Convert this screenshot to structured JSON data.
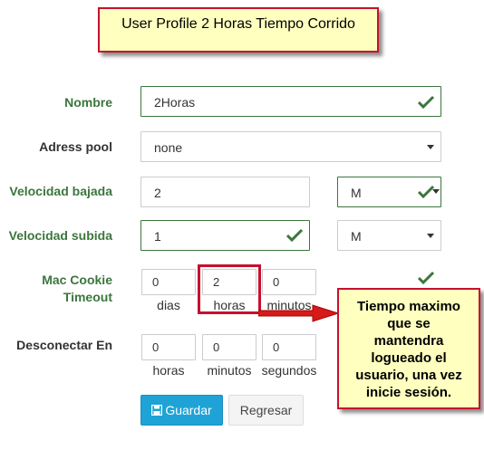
{
  "title": "User Profile 2 Horas Tiempo Corrido",
  "form": {
    "nombre": {
      "label": "Nombre",
      "value": "2Horas"
    },
    "adress_pool": {
      "label": "Adress pool",
      "value": "none"
    },
    "velocidad_bajada": {
      "label": "Velocidad bajada",
      "value": "2",
      "unit": "M"
    },
    "velocidad_subida": {
      "label": "Velocidad subida",
      "value": "1",
      "unit": "M"
    },
    "mac_cookie_timeout": {
      "label_line1": "Mac Cookie",
      "label_line2": "Timeout",
      "dias": "0",
      "horas": "2",
      "minutos": "0",
      "dias_label": "dias",
      "horas_label": "horas",
      "minutos_label": "minutos"
    },
    "desconectar_en": {
      "label": "Desconectar En",
      "horas": "0",
      "minutos": "0",
      "segundos": "0",
      "horas_label": "horas",
      "minutos_label": "minutos",
      "segundos_label": "segundos"
    }
  },
  "buttons": {
    "save": "Guardar",
    "back": "Regresar"
  },
  "note": {
    "lines": [
      "Tiempo maximo",
      "que se",
      "mantendra",
      "logueado el",
      "usuario, una vez",
      "inicie sesión."
    ]
  },
  "colors": {
    "success": "#3c763d",
    "primary": "#1fa3d6",
    "annotation_border": "#c8102e",
    "annotation_fill": "#ffffc0"
  },
  "icons": {
    "valid": "check-icon",
    "dropdown": "caret-down-icon",
    "save": "floppy-disk-icon",
    "pointer": "arrow-icon"
  }
}
